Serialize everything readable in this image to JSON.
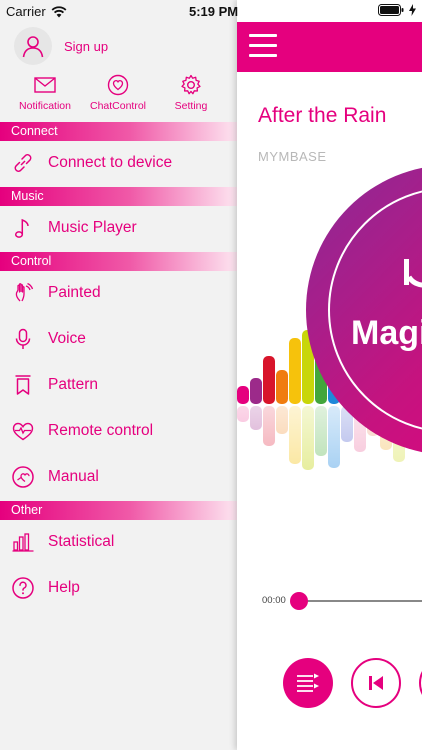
{
  "status_bar": {
    "carrier": "Carrier",
    "time": "5:19 PM"
  },
  "drawer": {
    "signup_label": "Sign up",
    "quick_actions": [
      {
        "label": "Notification",
        "icon": "envelope-icon"
      },
      {
        "label": "ChatControl",
        "icon": "heart-chat-icon"
      },
      {
        "label": "Setting",
        "icon": "gear-icon"
      }
    ],
    "sections": {
      "connect": "Connect",
      "music": "Music",
      "control": "Control",
      "other": "Other"
    },
    "items": {
      "connect_device": "Connect to device",
      "music_player": "Music Player",
      "painted": "Painted",
      "voice": "Voice",
      "pattern": "Pattern",
      "remote_control": "Remote control",
      "manual": "Manual",
      "statistical": "Statistical",
      "help": "Help"
    }
  },
  "player": {
    "title": "After the Rain",
    "artist": "MYMBASE",
    "disc_text": "Magi",
    "current_time": "00:00"
  },
  "colors": {
    "accent": "#e5007e",
    "drawer_bg": "#f2f2f2",
    "artist_text": "#b8b8b8"
  }
}
